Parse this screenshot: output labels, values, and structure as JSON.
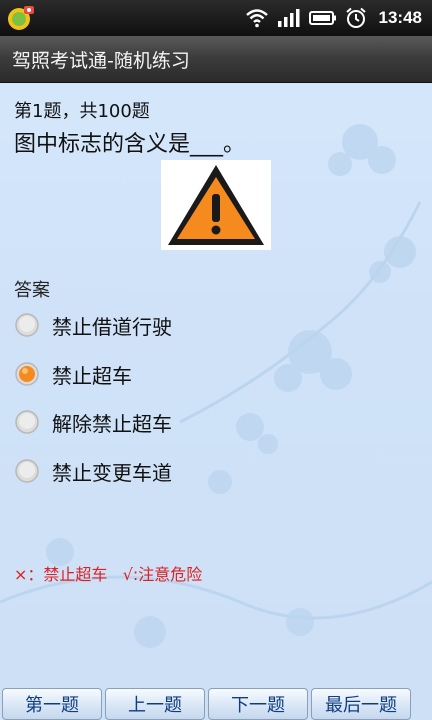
{
  "status": {
    "time": "13:48"
  },
  "app": {
    "title": "驾照考试通-随机练习"
  },
  "question": {
    "progress": "第1题，共100题",
    "text": "图中标志的含义是___。"
  },
  "answers": {
    "label": "答案",
    "options": [
      {
        "label": "禁止借道行驶",
        "selected": false
      },
      {
        "label": "禁止超车",
        "selected": true
      },
      {
        "label": "解除禁止超车",
        "selected": false
      },
      {
        "label": "禁止变更车道",
        "selected": false
      }
    ]
  },
  "result": {
    "wrong": "×：禁止超车",
    "right": "√:注意危险"
  },
  "nav": {
    "first": "第一题",
    "prev": "上一题",
    "next": "下一题",
    "last": "最后一题"
  },
  "colors": {
    "accent_orange": "#f58a1f",
    "result_red": "#e02020",
    "nav_text": "#0f3d82"
  }
}
